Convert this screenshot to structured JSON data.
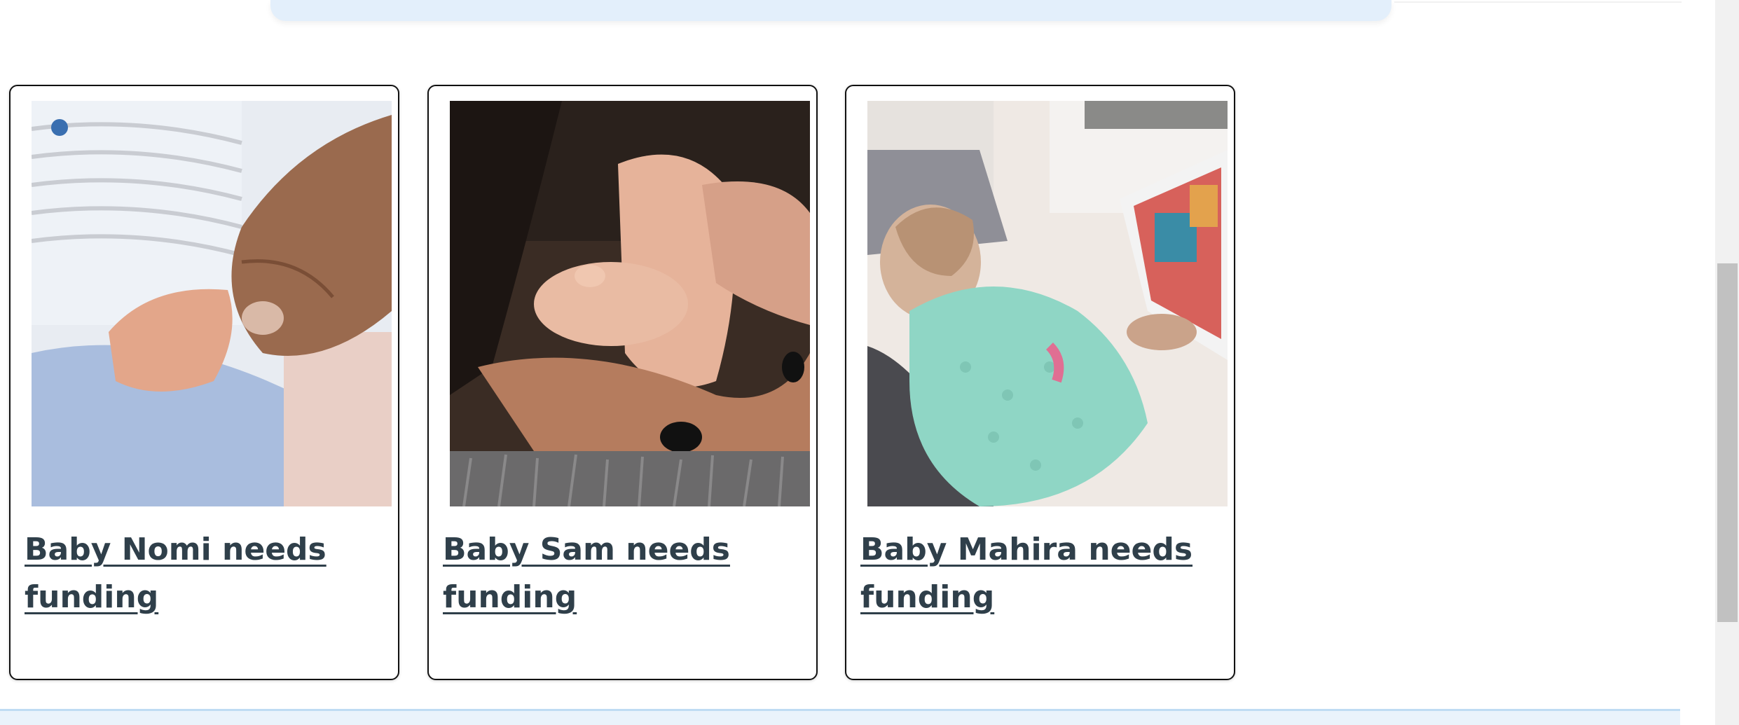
{
  "cards": [
    {
      "title": "Baby Nomi needs funding",
      "image": "baby-hand-holding-finger-image"
    },
    {
      "title": "Baby Sam needs funding",
      "image": "baby-feet-in-hand-image"
    },
    {
      "title": "Baby Mahira needs funding",
      "image": "baby-reading-book-image"
    }
  ],
  "colors": {
    "link": "#2f3f4a",
    "panel": "#e3effb",
    "strip": "#eaf3fb",
    "strip_border": "#bfdcf3"
  }
}
